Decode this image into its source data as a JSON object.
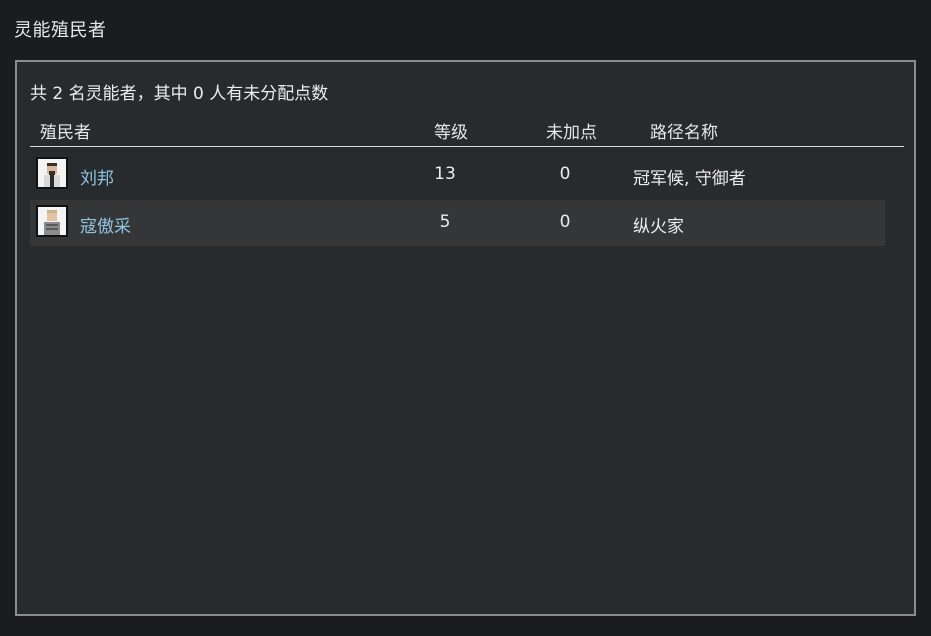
{
  "window": {
    "title": "灵能殖民者"
  },
  "summary": "共 2 名灵能者，其中 0 人有未分配点数",
  "table": {
    "columns": {
      "name": "殖民者",
      "level": "等级",
      "unspent": "未加点",
      "path": "路径名称"
    },
    "rows": [
      {
        "name": "刘邦",
        "level": "13",
        "unspent": "0",
        "path": "冠军候, 守御者",
        "avatar_icon": "colonist-portrait-icon"
      },
      {
        "name": "寇傲采",
        "level": "5",
        "unspent": "0",
        "path": "纵火家",
        "avatar_icon": "colonist-portrait-icon"
      }
    ]
  },
  "colors": {
    "background": "#1a1c1f",
    "panel": "#282b2e",
    "panel_border": "#8a8d90",
    "name_link": "#8fc3df",
    "alt_row": "#353638"
  }
}
